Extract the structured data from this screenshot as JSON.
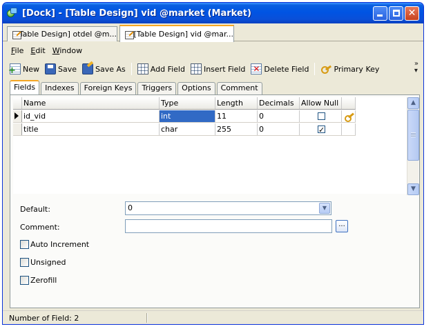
{
  "window": {
    "title": "[Dock] - [Table Design] vid @market (Market)",
    "controls": {
      "minimize": "–",
      "maximize": "□",
      "close": "✕"
    }
  },
  "doc_tabs": [
    {
      "label": "[Table Design] otdel @m..."
    },
    {
      "label": "[Table Design] vid @mar..."
    }
  ],
  "menu": [
    {
      "key": "F",
      "rest": "ile"
    },
    {
      "key": "E",
      "rest": "dit"
    },
    {
      "key": "W",
      "rest": "indow"
    }
  ],
  "toolbar": {
    "new": "New",
    "save": "Save",
    "save_as": "Save As",
    "add_field": "Add Field",
    "insert_field": "Insert Field",
    "delete_field": "Delete Field",
    "primary_key": "Primary Key",
    "overflow": "»"
  },
  "subtabs": [
    "Fields",
    "Indexes",
    "Foreign Keys",
    "Triggers",
    "Options",
    "Comment"
  ],
  "grid": {
    "columns": [
      "Name",
      "Type",
      "Length",
      "Decimals",
      "Allow Null"
    ],
    "rows": [
      {
        "name": "id_vid",
        "type": "int",
        "length": "11",
        "decimals": "0",
        "allow_null": false,
        "primary_key": true
      },
      {
        "name": "title",
        "type": "char",
        "length": "255",
        "decimals": "0",
        "allow_null": true,
        "primary_key": false
      }
    ]
  },
  "properties": {
    "default_label": "Default:",
    "default_value": "0",
    "comment_label": "Comment:",
    "comment_value": "",
    "browse_button": "...",
    "auto_increment": "Auto Increment",
    "unsigned": "Unsigned",
    "zerofill": "Zerofill"
  },
  "status": {
    "fields": "Number of Field: 2"
  },
  "colors": {
    "selection": "#316ac5",
    "titlebar": "#0054e3",
    "tab_accent": "#f5a623"
  }
}
